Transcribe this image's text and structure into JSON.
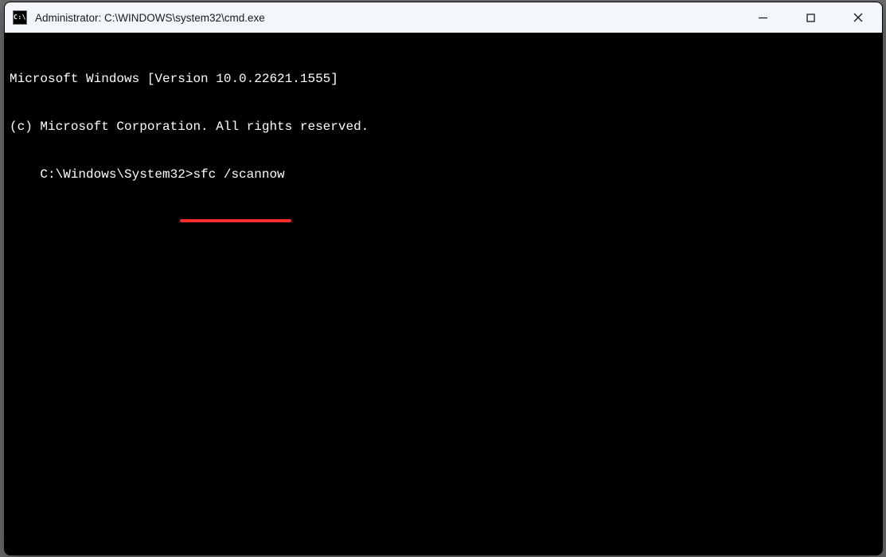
{
  "window": {
    "title": "Administrator: C:\\WINDOWS\\system32\\cmd.exe"
  },
  "terminal": {
    "line1": "Microsoft Windows [Version 10.0.22621.1555]",
    "line2": "(c) Microsoft Corporation. All rights reserved.",
    "prompt": "C:\\Windows\\System32>",
    "command": "sfc /scannow"
  },
  "annotation": {
    "underline_color": "#ff2c2c"
  }
}
